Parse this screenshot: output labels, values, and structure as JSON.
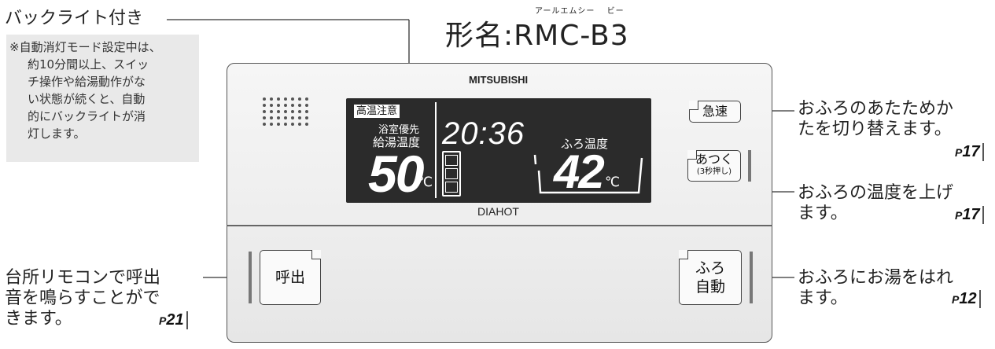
{
  "model": {
    "ruby": "アールエムシー　 ビー",
    "title": "形名:RMC-B3"
  },
  "backlight": {
    "label": "バックライト付き",
    "note": [
      "※自動消灯モード設定中は、",
      "約10分間以上、スイッ",
      "チ操作や給湯動作がな",
      "い状態が続くと、自動",
      "的にバックライトが消",
      "灯します。"
    ]
  },
  "device": {
    "brand": "MITSUBISHI",
    "maker": "DIAHOT",
    "lcd": {
      "high_temp_label": "高温注意",
      "bath_priority": "浴室優先",
      "supply_temp_label": "給湯温度",
      "clock": "20:36",
      "supply_temp": "50",
      "unit": "℃",
      "bath_temp_label": "ふろ温度",
      "bath_temp": "42"
    },
    "buttons": {
      "rapid": "急速",
      "hot_line1": "あつく",
      "hot_line2": "(3秒押し)",
      "call": "呼出",
      "auto_line1": "ふろ",
      "auto_line2": "自動"
    }
  },
  "callouts": {
    "rapid": {
      "lines": [
        "おふろのあたためか",
        "たを切り替えます。"
      ],
      "page": "17"
    },
    "hot": {
      "lines": [
        "おふろの温度を上げ",
        "ます。"
      ],
      "page": "17"
    },
    "auto": {
      "lines": [
        "おふろにお湯をはれ",
        "ます。"
      ],
      "page": "12"
    },
    "call": {
      "lines": [
        "台所リモコンで呼出",
        "音を鳴らすことがで",
        "きます。"
      ],
      "page": "21"
    }
  },
  "page_prefix": "P"
}
